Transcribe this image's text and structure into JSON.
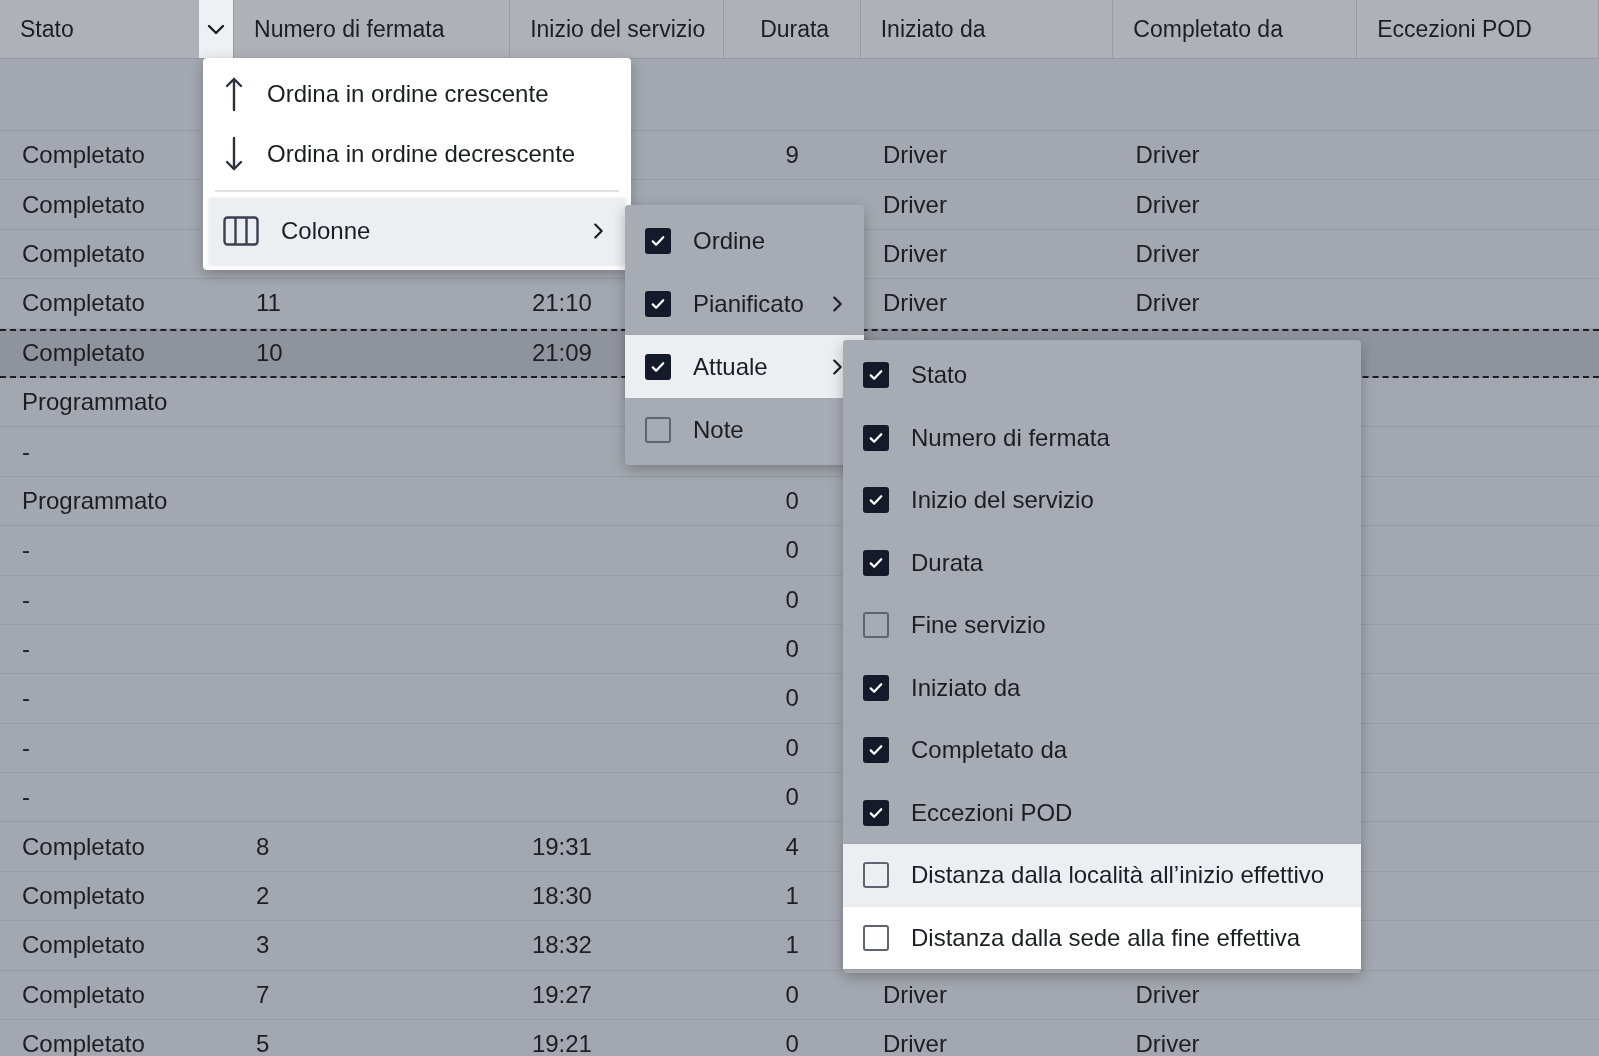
{
  "table": {
    "menu_open": true,
    "columns": [
      "Stato",
      "Numero di fermata",
      "Inizio del servizio",
      "Durata",
      "Iniziato da",
      "Completato da",
      "Eccezioni POD"
    ],
    "rows": [
      {
        "kind": "blank",
        "selected": false,
        "cells": []
      },
      {
        "kind": "data",
        "selected": false,
        "cells": [
          "Completato",
          null,
          null,
          "9",
          "Driver",
          "Driver"
        ]
      },
      {
        "kind": "data",
        "selected": false,
        "cells": [
          "Completato",
          null,
          null,
          null,
          "Driver",
          "Driver"
        ]
      },
      {
        "kind": "data",
        "selected": false,
        "cells": [
          "Completato",
          null,
          null,
          null,
          "Driver",
          "Driver"
        ]
      },
      {
        "kind": "data",
        "selected": false,
        "cells": [
          "Completato",
          "11",
          "21:10",
          null,
          "Driver",
          "Driver"
        ]
      },
      {
        "kind": "data",
        "selected": true,
        "cells": [
          "Completato",
          "10",
          "21:09"
        ]
      },
      {
        "kind": "data",
        "selected": false,
        "cells": [
          "Programmato"
        ]
      },
      {
        "kind": "data",
        "selected": false,
        "cells": [
          "-"
        ]
      },
      {
        "kind": "data",
        "selected": false,
        "cells": [
          "Programmato",
          null,
          null,
          "0"
        ]
      },
      {
        "kind": "data",
        "selected": false,
        "cells": [
          "-",
          null,
          null,
          "0"
        ]
      },
      {
        "kind": "data",
        "selected": false,
        "cells": [
          "-",
          null,
          null,
          "0"
        ]
      },
      {
        "kind": "data",
        "selected": false,
        "cells": [
          "-",
          null,
          null,
          "0"
        ]
      },
      {
        "kind": "data",
        "selected": false,
        "cells": [
          "-",
          null,
          null,
          "0"
        ]
      },
      {
        "kind": "data",
        "selected": false,
        "cells": [
          "-",
          null,
          null,
          "0"
        ]
      },
      {
        "kind": "data",
        "selected": false,
        "cells": [
          "-",
          null,
          null,
          "0"
        ]
      },
      {
        "kind": "data",
        "selected": false,
        "cells": [
          "Completato",
          "8",
          "19:31",
          "4"
        ]
      },
      {
        "kind": "data",
        "selected": false,
        "cells": [
          "Completato",
          "2",
          "18:30",
          "1"
        ]
      },
      {
        "kind": "data",
        "selected": false,
        "cells": [
          "Completato",
          "3",
          "18:32",
          "1"
        ]
      },
      {
        "kind": "data",
        "selected": false,
        "cells": [
          "Completato",
          "7",
          "19:27",
          "0",
          "Driver",
          "Driver"
        ]
      },
      {
        "kind": "data",
        "selected": false,
        "cells": [
          "Completato",
          "5",
          "19:21",
          "0",
          "Driver",
          "Driver"
        ]
      }
    ]
  },
  "column_menu": {
    "items": [
      {
        "kind": "sort-asc",
        "label": "Ordina in ordine crescente",
        "selected": false,
        "submenu": false
      },
      {
        "kind": "sort-desc",
        "label": "Ordina in ordine decrescente",
        "selected": false,
        "submenu": false
      },
      {
        "kind": "columns",
        "label": "Colonne",
        "selected": true,
        "submenu": true
      }
    ]
  },
  "columns_submenu": {
    "items": [
      {
        "label": "Ordine",
        "checked": true,
        "selected": false,
        "dimmed": true,
        "submenu": false
      },
      {
        "label": "Pianificato",
        "checked": true,
        "selected": false,
        "dimmed": true,
        "submenu": true
      },
      {
        "label": "Attuale",
        "checked": true,
        "selected": true,
        "dimmed": false,
        "submenu": true
      },
      {
        "label": "Note",
        "checked": false,
        "selected": false,
        "dimmed": true,
        "submenu": false
      }
    ]
  },
  "actual_submenu": {
    "items": [
      {
        "label": "Stato",
        "checked": true,
        "selected": false,
        "dimmed": true
      },
      {
        "label": "Numero di fermata",
        "checked": true,
        "selected": false,
        "dimmed": true
      },
      {
        "label": "Inizio del servizio",
        "checked": true,
        "selected": false,
        "dimmed": true
      },
      {
        "label": "Durata",
        "checked": true,
        "selected": false,
        "dimmed": true
      },
      {
        "label": "Fine servizio",
        "checked": false,
        "selected": false,
        "dimmed": true
      },
      {
        "label": "Iniziato da",
        "checked": true,
        "selected": false,
        "dimmed": true
      },
      {
        "label": "Completato da",
        "checked": true,
        "selected": false,
        "dimmed": true
      },
      {
        "label": "Eccezioni POD",
        "checked": true,
        "selected": false,
        "dimmed": true
      },
      {
        "label": "Distanza dalla località all’inizio effettivo",
        "checked": false,
        "selected": true,
        "dimmed": false
      },
      {
        "label": "Distanza dalla sede alla fine effettiva",
        "checked": false,
        "selected": false,
        "dimmed": false
      }
    ]
  }
}
